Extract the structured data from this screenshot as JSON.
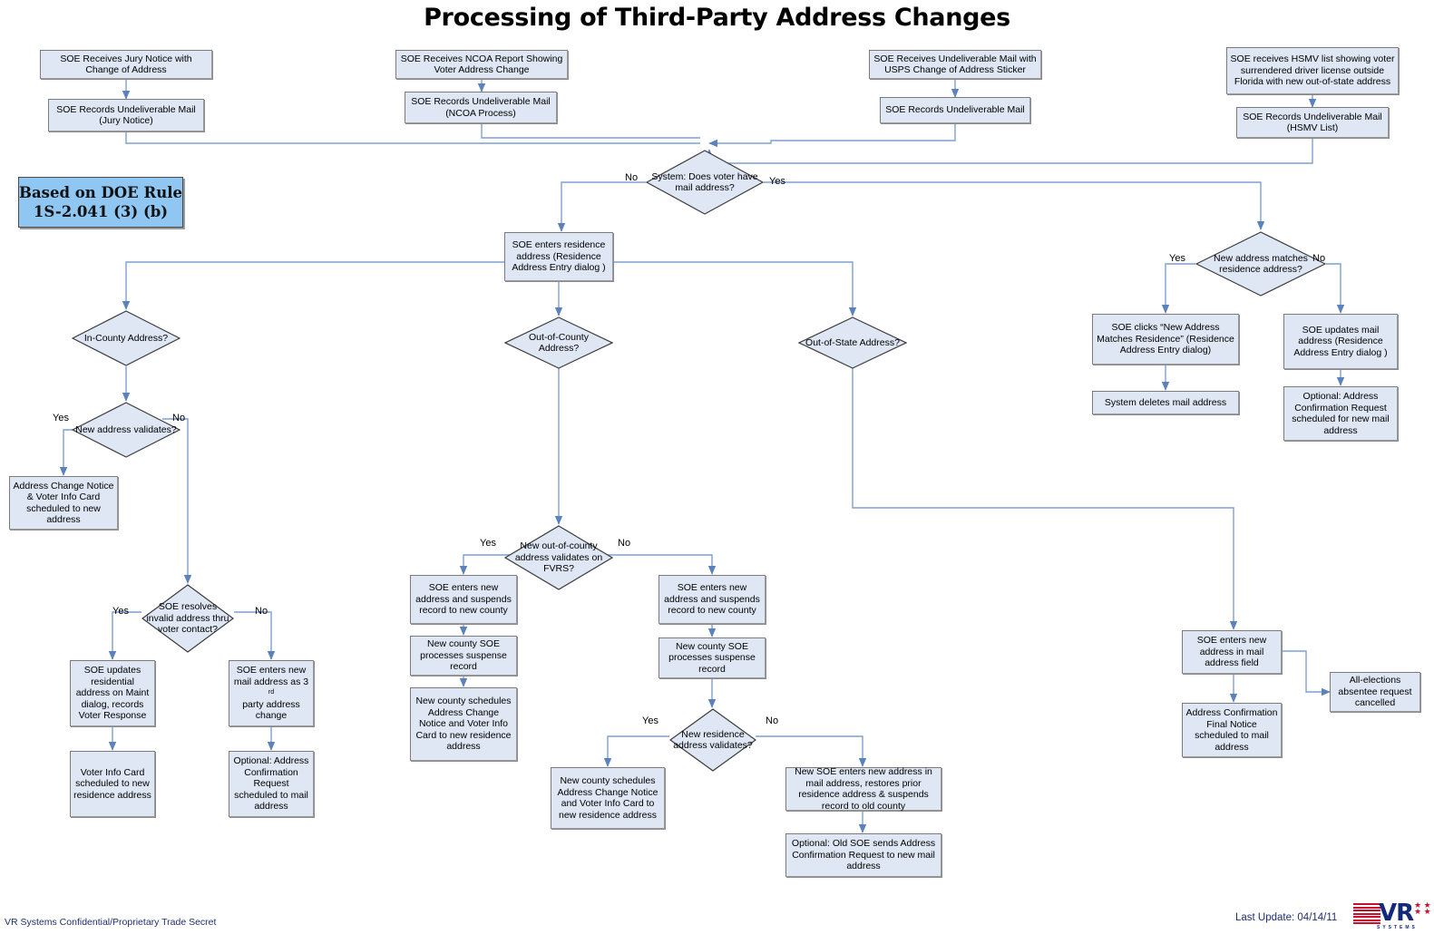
{
  "title": "Processing of Third-Party Address Changes",
  "rule_box": "Based on DOE Rule\n1S-2.041 (3) (b)",
  "rule_box_line1": "Based on DOE Rule",
  "rule_box_line2": "1S-2.041 (3) (b)",
  "footer": {
    "confidential": "VR Systems Confidential/Proprietary Trade Secret",
    "last_update": "Last Update: 04/14/11",
    "logo_text": "VR",
    "logo_sub": "SYSTEMS"
  },
  "colors": {
    "node_fill": "#DEE7F3",
    "node_border": "#808080",
    "connector": "#6F92C4",
    "rule_fill": "#8FC7F2",
    "text": "#000000",
    "footer_text": "#1F2E6E",
    "logo_red": "#C8102E",
    "logo_blue": "#13297A"
  },
  "nodes": {
    "n1": {
      "label": "SOE Receives Jury Notice with Change of Address",
      "type": "process"
    },
    "n2": {
      "label": "SOE Records Undeliverable Mail (Jury Notice)",
      "type": "process"
    },
    "n3": {
      "label": "SOE Receives NCOA Report Showing Voter Address Change",
      "type": "process"
    },
    "n4": {
      "label": "SOE Records Undeliverable Mail (NCOA Process)",
      "type": "process"
    },
    "n5": {
      "label": "SOE Receives Undeliverable Mail with USPS Change of Address Sticker",
      "type": "process"
    },
    "n6": {
      "label": "SOE Records Undeliverable Mail",
      "type": "process"
    },
    "n7": {
      "label": "SOE receives HSMV list showing voter surrendered driver license outside Florida with new out-of-state address",
      "type": "process"
    },
    "n8": {
      "label": "SOE Records Undeliverable Mail (HSMV List)",
      "type": "process"
    },
    "d1": {
      "label": "System: Does voter have mail address?",
      "type": "decision"
    },
    "n9": {
      "label": "SOE enters residence address (Residence Address Entry dialog )",
      "type": "process"
    },
    "d2": {
      "label": "New address matches residence address?",
      "type": "decision"
    },
    "n10": {
      "label": "SOE clicks “New Address Matches Residence” (Residence Address Entry dialog)",
      "type": "process"
    },
    "n11": {
      "label": "System deletes mail address",
      "type": "process"
    },
    "n12": {
      "label": "SOE updates mail address (Residence Address Entry dialog )",
      "type": "process"
    },
    "n13": {
      "label": "Optional: Address Confirmation Request scheduled for new mail address",
      "type": "process"
    },
    "d3": {
      "label": "In-County Address?",
      "type": "decision"
    },
    "d4": {
      "label": "New address validates?",
      "type": "decision"
    },
    "n14": {
      "label": "Address Change Notice & Voter Info Card scheduled to new address",
      "type": "process"
    },
    "d5": {
      "label": "SOE resolves invalid address thru voter contact?",
      "type": "decision"
    },
    "n15": {
      "label": "SOE updates residential address on Maint dialog, records Voter Response",
      "type": "process"
    },
    "n16": {
      "label": "Voter Info Card scheduled to  new residence address",
      "type": "process"
    },
    "n17": {
      "label": "SOE enters new mail address as 3rd party address change",
      "type": "process"
    },
    "n18": {
      "label": "Optional: Address Confirmation Request scheduled to mail address",
      "type": "process"
    },
    "d6": {
      "label": "Out-of-County Address?",
      "type": "decision"
    },
    "d7": {
      "label": "New out-of-county address validates on FVRS?",
      "type": "decision"
    },
    "n19": {
      "label": "SOE enters new address and suspends record to new county",
      "type": "process"
    },
    "n20": {
      "label": "New county SOE processes suspense record",
      "type": "process"
    },
    "n21": {
      "label": "New county schedules Address Change Notice and Voter Info Card to new residence address",
      "type": "process"
    },
    "n22": {
      "label": "SOE enters new address and suspends record to new county",
      "type": "process"
    },
    "n23": {
      "label": "New county SOE processes suspense record",
      "type": "process"
    },
    "d8": {
      "label": "New residence address validates?",
      "type": "decision"
    },
    "n24": {
      "label": "New county schedules Address Change Notice and Voter Info Card to new residence address",
      "type": "process"
    },
    "n25": {
      "label": "New SOE enters new address in mail address, restores prior residence address & suspends record to old county",
      "type": "process"
    },
    "n26": {
      "label": "Optional: Old SOE sends Address Confirmation Request to new mail address",
      "type": "process"
    },
    "d9": {
      "label": "Out-of-State Address?",
      "type": "decision"
    },
    "n27": {
      "label": "SOE enters new address in mail address field",
      "type": "process"
    },
    "n28": {
      "label": "Address Confirmation Final Notice scheduled to mail address",
      "type": "process"
    },
    "n29": {
      "label": "All-elections absentee request cancelled",
      "type": "process"
    }
  },
  "edge_labels": {
    "e1": "No",
    "e2": "Yes",
    "e3": "Yes",
    "e4": "No",
    "e5": "Yes",
    "e6": "No",
    "e7": "Yes",
    "e8": "No",
    "e9": "Yes",
    "e10": "No",
    "e11": "Yes",
    "e12": "No"
  }
}
